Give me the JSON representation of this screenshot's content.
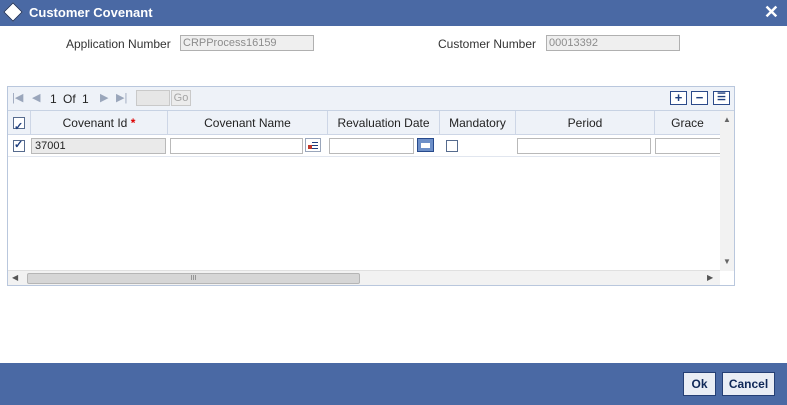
{
  "window": {
    "title": "Customer Covenant"
  },
  "fields": {
    "application_number_label": "Application Number",
    "application_number_value": "CRPProcess16159",
    "customer_number_label": "Customer Number",
    "customer_number_value": "00013392"
  },
  "pager": {
    "current": "1",
    "of_label": "Of",
    "total": "1",
    "go_label": "Go"
  },
  "grid": {
    "columns": [
      "Covenant Id",
      "Covenant Name",
      "Revaluation Date",
      "Mandatory",
      "Period",
      "Grace"
    ],
    "required_marker": "*",
    "rows": [
      {
        "selected": true,
        "covenant_id": "37001",
        "covenant_name": "",
        "revaluation_date": "",
        "mandatory": false,
        "period": "",
        "grace": ""
      }
    ],
    "scroll_grip": "III"
  },
  "buttons": {
    "ok": "Ok",
    "cancel": "Cancel"
  },
  "colors": {
    "titlebar": "#4a69a4",
    "footer": "#4a69a4"
  }
}
